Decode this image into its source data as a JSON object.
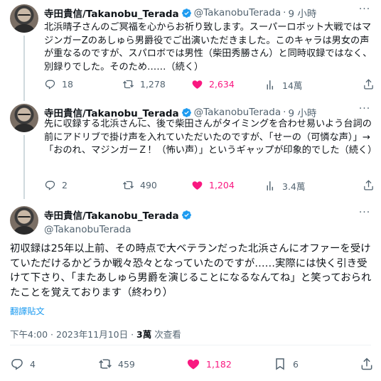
{
  "author": {
    "name": "寺田貴信/Takanobu_Terada",
    "handle": "@TakanobuTerada",
    "separator": "·"
  },
  "tweets": [
    {
      "time": "9 小時",
      "text": "北浜晴子さんのご冥福を心からお祈り致します。スーパーロボット大戦ではマジンガーZのあしゅら男爵役でご出演いただきました。このキャラは男女の声が重なるのですが、スパロボでは男性（柴田秀勝さん）と同時収録ではなく、別録りでした。そのため……（続く）",
      "replies": "18",
      "retweets": "1,278",
      "likes": "2,634",
      "views": "14萬"
    },
    {
      "time": "9 小時",
      "text": "先に収録する北浜さんに、後で柴田さんがタイミングを合わせ易いよう台詞の前にアドリブで掛け声を入れていただいたのですが、「せーの（可憐な声）」→「おのれ、マジンガーＺ！（怖い声）」というギャップが印象的でした（続く）",
      "replies": "2",
      "retweets": "490",
      "likes": "1,204",
      "views": "3.4萬"
    }
  ],
  "main_tweet": {
    "text": "初収録は25年以上前、その時点で大ベテランだった北浜さんにオファーを受けていただけるかどうか戦々恐々となっていたのですが……実際には快く引き受けて下さり、「またあしゅら男爵を演じることになるなんてね」と笑っておられたことを覚えております（終わり）",
    "translate_label": "翻譯貼文",
    "timestamp": "下午4:00 · 2023年11月10日 · ",
    "views_count": "3萬",
    "views_label": " 次查看",
    "replies": "4",
    "retweets": "459",
    "likes": "1,182",
    "bookmarks": "6"
  },
  "colors": {
    "like": "#f91880",
    "verified": "#1d9bf0",
    "secondary": "#536471",
    "link": "#1d9bf0"
  },
  "icons": [
    "more-icon",
    "verified-icon",
    "reply-icon",
    "retweet-icon",
    "heart-icon",
    "views-icon",
    "bookmark-icon",
    "share-icon"
  ]
}
